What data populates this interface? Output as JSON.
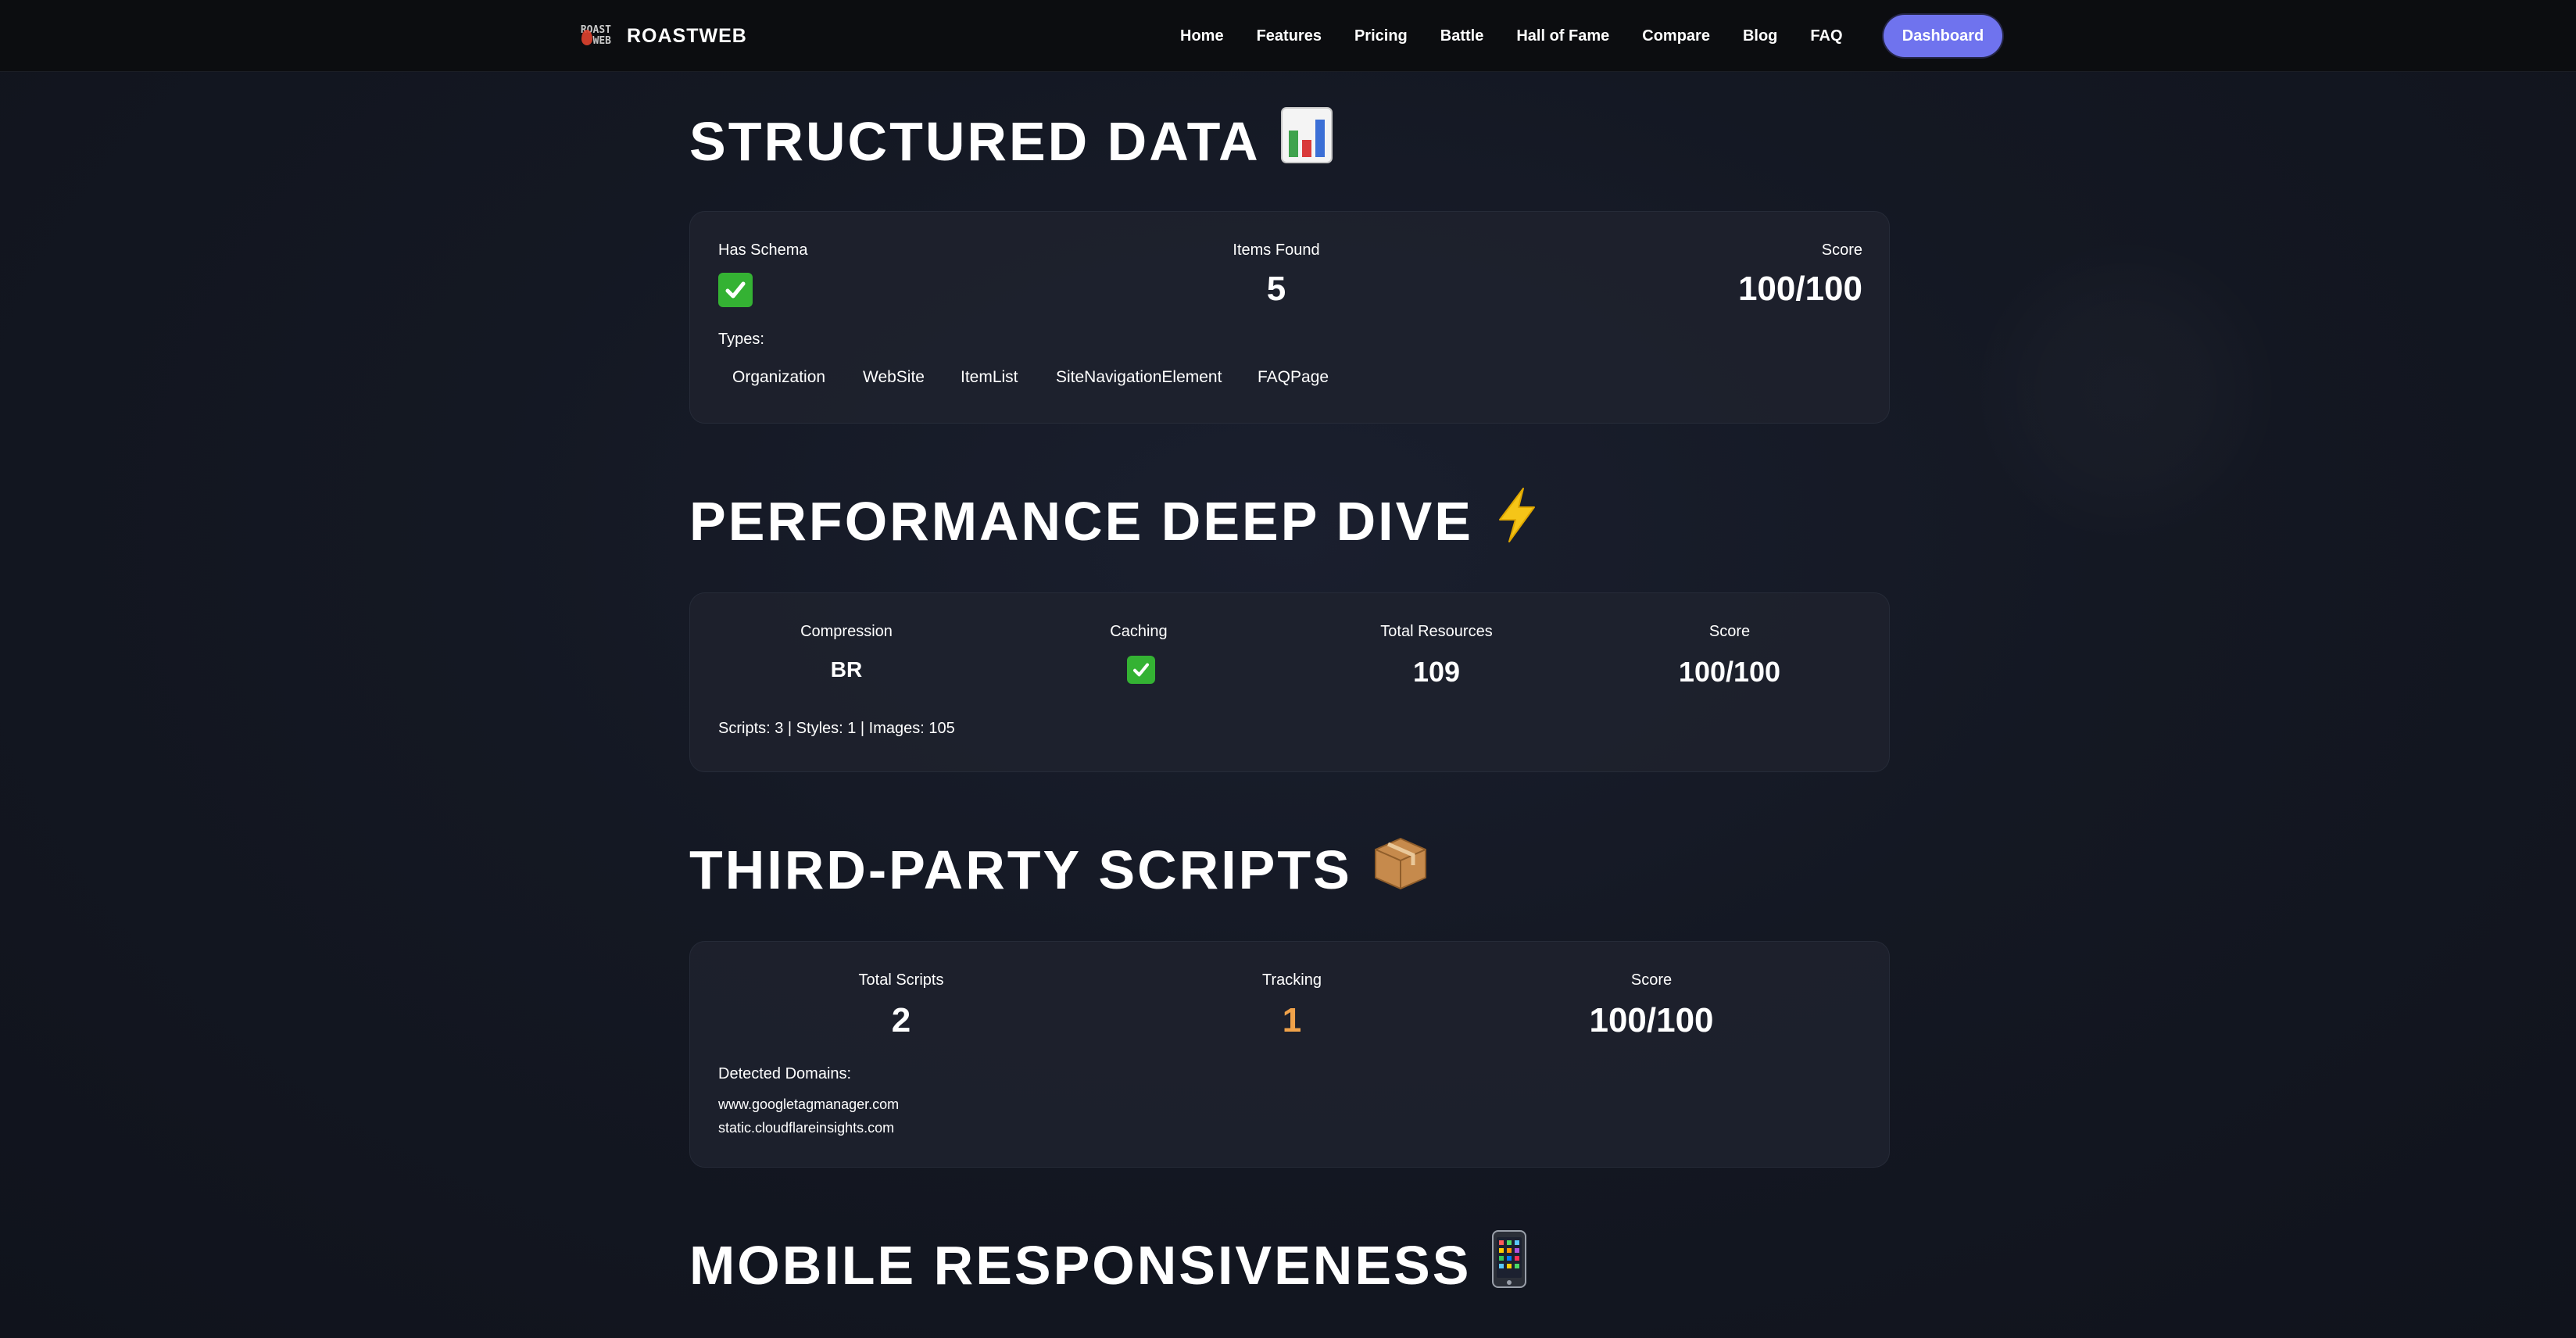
{
  "nav": {
    "logo_mark": "ROAST WEB",
    "brand": "ROASTWEB",
    "links": [
      "Home",
      "Features",
      "Pricing",
      "Battle",
      "Hall of Fame",
      "Compare",
      "Blog",
      "FAQ"
    ],
    "cta": "Dashboard",
    "accent": "#6f73ee"
  },
  "structured_data": {
    "title": "STRUCTURED DATA",
    "icon": "bar-chart-icon",
    "has_schema_label": "Has Schema",
    "items_found_label": "Items Found",
    "items_found_value": "5",
    "score_label": "Score",
    "score_value": "100/100",
    "types_label": "Types:",
    "types": [
      "Organization",
      "WebSite",
      "ItemList",
      "SiteNavigationElement",
      "FAQPage"
    ]
  },
  "performance": {
    "title": "PERFORMANCE DEEP DIVE",
    "icon": "lightning-icon",
    "compression_label": "Compression",
    "compression_value": "BR",
    "caching_label": "Caching",
    "total_resources_label": "Total Resources",
    "total_resources_value": "109",
    "score_label": "Score",
    "score_value": "100/100",
    "breakdown": "Scripts: 3 | Styles: 1 | Images: 105"
  },
  "third_party": {
    "title": "THIRD-PARTY SCRIPTS",
    "icon": "package-icon",
    "total_scripts_label": "Total Scripts",
    "total_scripts_value": "2",
    "tracking_label": "Tracking",
    "tracking_value": "1",
    "score_label": "Score",
    "score_value": "100/100",
    "domains_label": "Detected Domains:",
    "domains": [
      "www.googletagmanager.com",
      "static.cloudflareinsights.com"
    ],
    "tracking_color": "#f0a24a"
  },
  "mobile": {
    "title": "MOBILE RESPONSIVENESS",
    "icon": "mobile-phone-icon"
  }
}
